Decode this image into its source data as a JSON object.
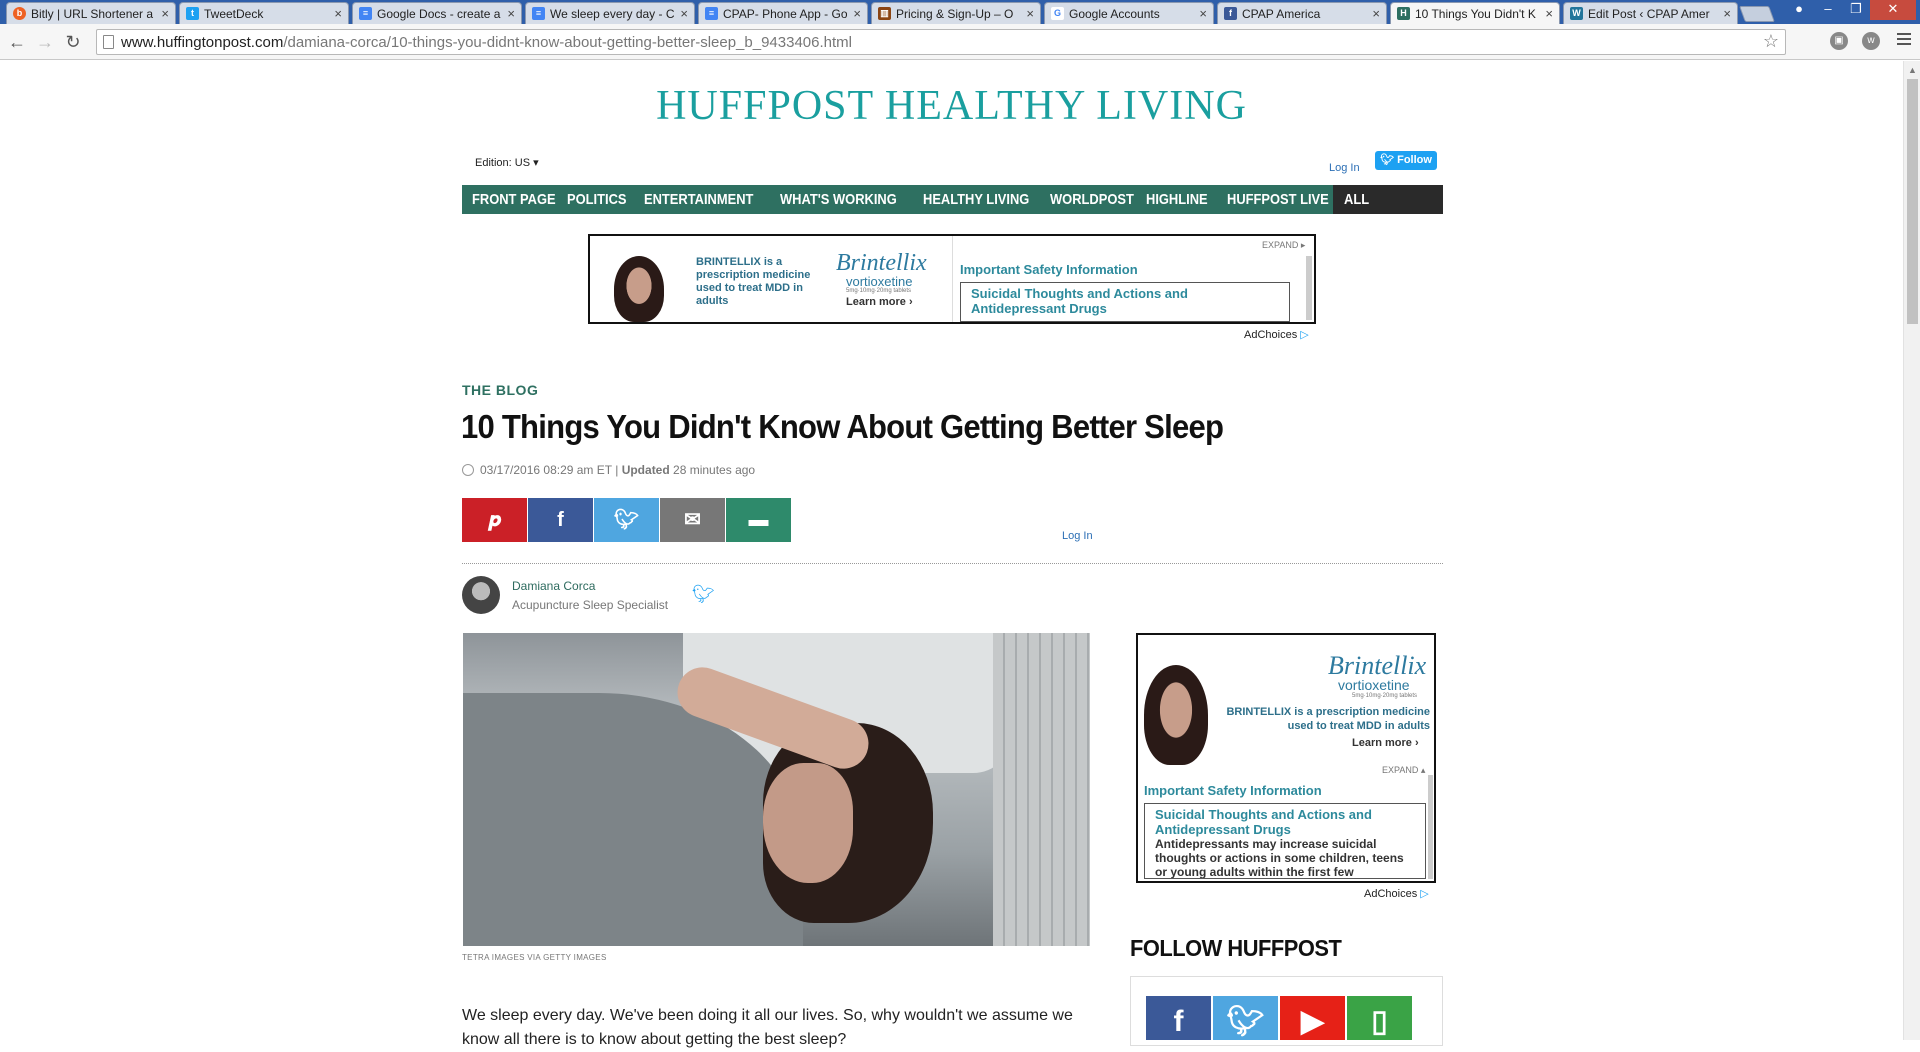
{
  "browser": {
    "tabs": [
      {
        "label": "Bitly | URL Shortener a",
        "icon": "bitly-icon",
        "color": "#ee6123"
      },
      {
        "label": "TweetDeck",
        "icon": "tweetdeck-icon",
        "color": "#1da1f2"
      },
      {
        "label": "Google Docs - create a",
        "icon": "docs-icon",
        "color": "#4285f4"
      },
      {
        "label": "We sleep every day - C",
        "icon": "docs-icon",
        "color": "#4285f4"
      },
      {
        "label": "CPAP- Phone App - Go",
        "icon": "docs-icon",
        "color": "#4285f4"
      },
      {
        "label": "Pricing & Sign-Up – O",
        "icon": "chart-icon",
        "color": "#8b4513"
      },
      {
        "label": "Google Accounts",
        "icon": "google-icon",
        "color": "#4285f4"
      },
      {
        "label": "CPAP America",
        "icon": "facebook-icon",
        "color": "#3b5998"
      },
      {
        "label": "10 Things You Didn't K",
        "icon": "huffpost-icon",
        "color": "#2e7061"
      },
      {
        "label": "Edit Post ‹ CPAP Amer",
        "icon": "wordpress-icon",
        "color": "#21759b"
      }
    ],
    "url_host": "www.huffingtonpost.com",
    "url_path": "/damiana-corca/10-things-you-didnt-know-about-getting-better-sleep_b_9433406.html"
  },
  "site": {
    "logo": "HUFFPOST HEALTHY LIVING",
    "edition": "Edition: US ▾",
    "login": "Log In",
    "follow": "Follow"
  },
  "nav": {
    "items": [
      "FRONT PAGE",
      "POLITICS",
      "ENTERTAINMENT",
      "WHAT'S WORKING",
      "HEALTHY LIVING",
      "WORLDPOST",
      "HIGHLINE",
      "HUFFPOST LIVE",
      "ALL SECTIONS"
    ]
  },
  "ad_top": {
    "brand_text": "BRINTELLIX is a prescription medicine used to treat MDD in adults",
    "brand_bold": "BRINTELLIX",
    "logo": "Brintellix",
    "logo_sub": "vortioxetine",
    "dose": "5mg·10mg·20mg tablets",
    "learn": "Learn more ›",
    "expand": "EXPAND ▸",
    "isi_title": "Important Safety Information",
    "isi_box": "Suicidal Thoughts and Actions and Antidepressant Drugs",
    "adchoices": "AdChoices"
  },
  "article": {
    "section": "THE BLOG",
    "headline": "10 Things You Didn't Know About Getting Better Sleep",
    "date": "03/17/2016 08:29 am ET",
    "updated_label": "Updated",
    "updated_value": "28 minutes ago",
    "login": "Log In",
    "author_name": "Damiana Corca",
    "author_title": "Acupuncture Sleep Specialist",
    "photo_credit": "TETRA IMAGES VIA GETTY IMAGES",
    "body": "We sleep every day. We've been doing it all our lives. So, why wouldn't we assume we know all there is to know about getting the best sleep?"
  },
  "share": {
    "buttons": [
      {
        "name": "pinterest",
        "color": "#cb2027"
      },
      {
        "name": "facebook",
        "color": "#3b5998"
      },
      {
        "name": "twitter",
        "color": "#4fa6e0"
      },
      {
        "name": "email",
        "color": "#777777"
      },
      {
        "name": "comment",
        "color": "#2e8a6b"
      }
    ]
  },
  "ad_side": {
    "logo": "Brintellix",
    "logo_sub": "vortioxetine",
    "dose": "5mg·10mg·20mg tablets",
    "brand_text": "BRINTELLIX is a prescription medicine used to treat MDD in adults",
    "learn": "Learn more ›",
    "expand": "EXPAND ▴",
    "isi_title": "Important Safety Information",
    "isi_box_title": "Suicidal Thoughts and Actions and Antidepressant Drugs",
    "isi_box_body": "Antidepressants may increase suicidal thoughts or actions in some children, teens or young adults within the first few",
    "adchoices": "AdChoices"
  },
  "follow": {
    "heading": "FOLLOW HUFFPOST",
    "networks": [
      {
        "name": "facebook",
        "color": "#3b5998"
      },
      {
        "name": "twitter",
        "color": "#4fa6e0"
      },
      {
        "name": "youtube",
        "color": "#e62117"
      },
      {
        "name": "mobile",
        "color": "#3aa346"
      }
    ]
  }
}
